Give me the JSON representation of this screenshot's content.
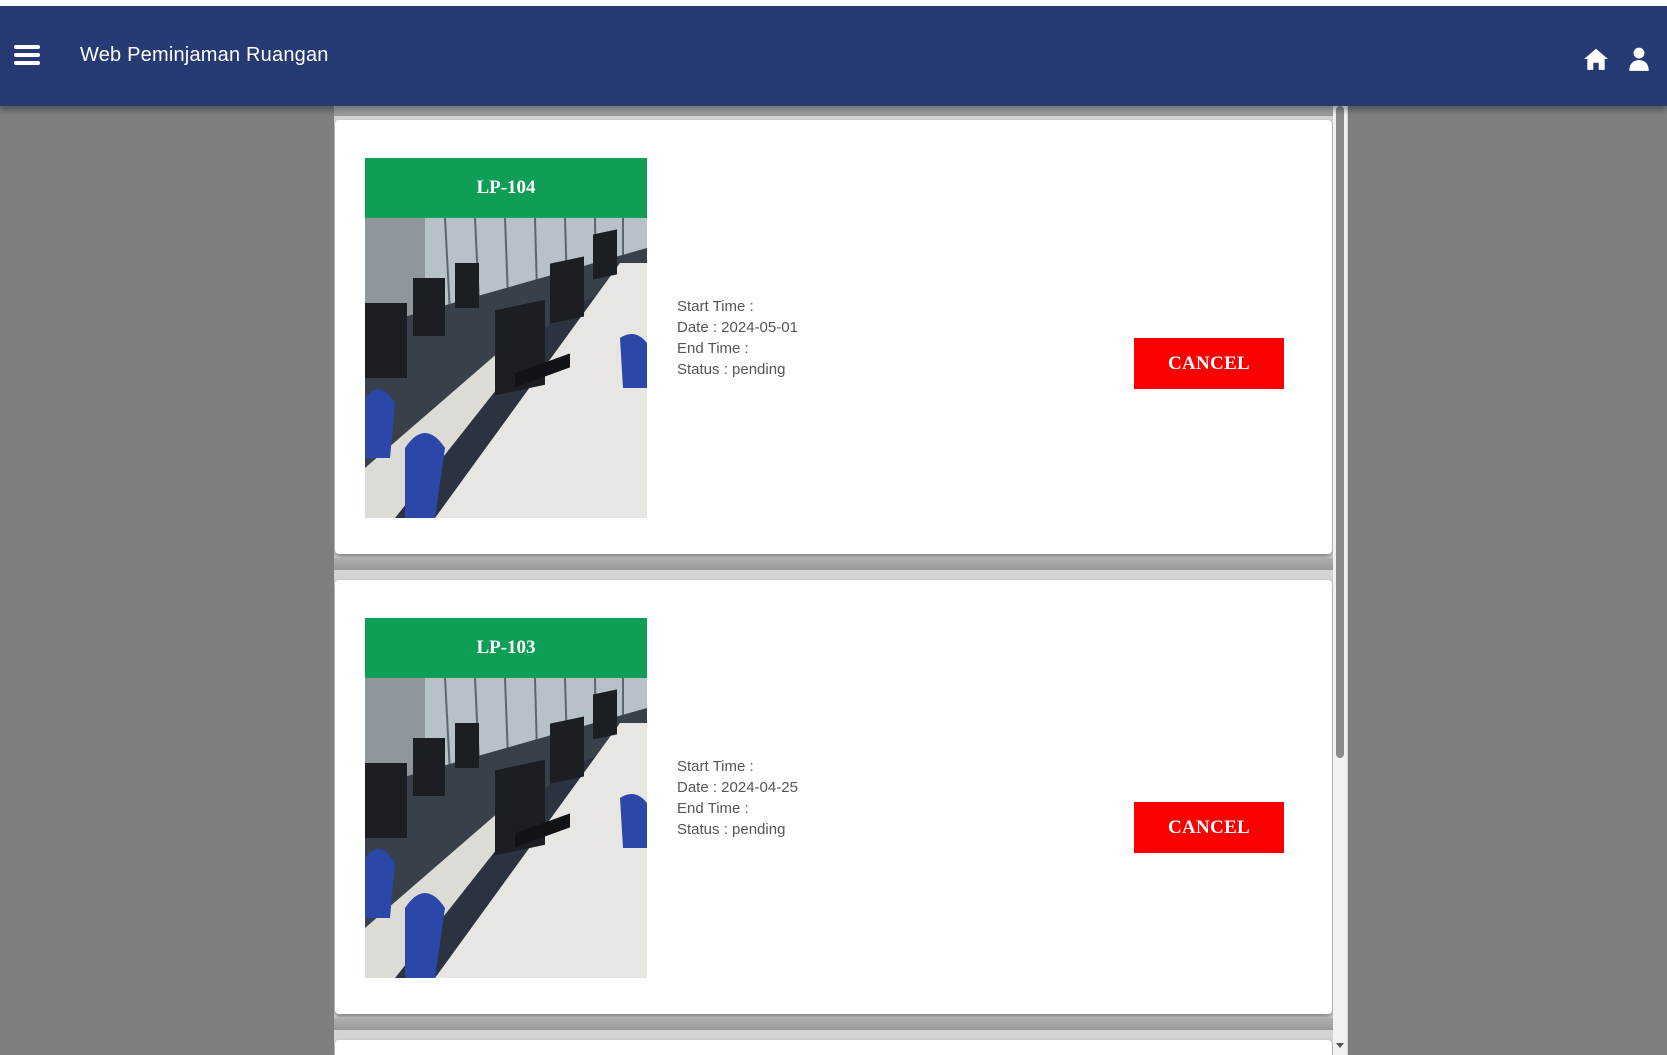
{
  "app": {
    "title": "Web Peminjaman Ruangan"
  },
  "icons": {
    "menu": "hamburger-menu-icon",
    "home": "home-icon",
    "user": "user-icon"
  },
  "colors": {
    "navbar": "#263b74",
    "room_header": "#0e9e55",
    "cancel_button": "#fa0000",
    "background": "#7f7f7f"
  },
  "bookings": [
    {
      "room": "LP-104",
      "start_time": "Start Time :",
      "date": "Date : 2024-05-01",
      "end_time": "End Time :",
      "status": "Status : pending",
      "action": "CANCEL"
    },
    {
      "room": "LP-103",
      "start_time": "Start Time :",
      "date": "Date : 2024-04-25",
      "end_time": "End Time :",
      "status": "Status : pending",
      "action": "CANCEL"
    }
  ]
}
